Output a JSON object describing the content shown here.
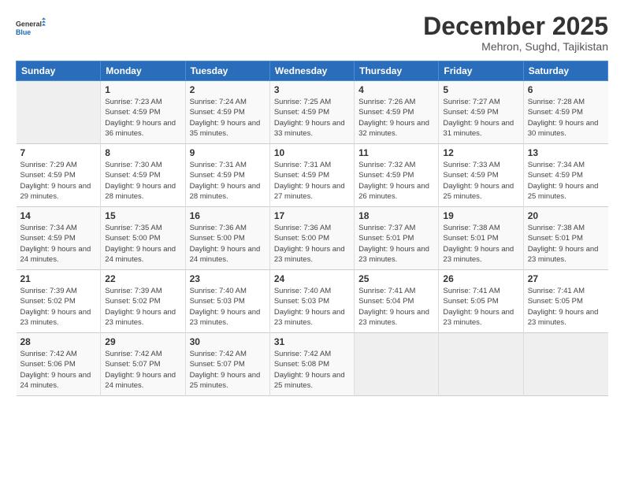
{
  "logo": {
    "line1": "General",
    "line2": "Blue"
  },
  "title": "December 2025",
  "location": "Mehron, Sughd, Tajikistan",
  "weekdays": [
    "Sunday",
    "Monday",
    "Tuesday",
    "Wednesday",
    "Thursday",
    "Friday",
    "Saturday"
  ],
  "weeks": [
    [
      {
        "day": "",
        "empty": true
      },
      {
        "day": "1",
        "rise": "7:23 AM",
        "set": "4:59 PM",
        "daylight": "9 hours and 36 minutes."
      },
      {
        "day": "2",
        "rise": "7:24 AM",
        "set": "4:59 PM",
        "daylight": "9 hours and 35 minutes."
      },
      {
        "day": "3",
        "rise": "7:25 AM",
        "set": "4:59 PM",
        "daylight": "9 hours and 33 minutes."
      },
      {
        "day": "4",
        "rise": "7:26 AM",
        "set": "4:59 PM",
        "daylight": "9 hours and 32 minutes."
      },
      {
        "day": "5",
        "rise": "7:27 AM",
        "set": "4:59 PM",
        "daylight": "9 hours and 31 minutes."
      },
      {
        "day": "6",
        "rise": "7:28 AM",
        "set": "4:59 PM",
        "daylight": "9 hours and 30 minutes."
      }
    ],
    [
      {
        "day": "7",
        "rise": "7:29 AM",
        "set": "4:59 PM",
        "daylight": "9 hours and 29 minutes."
      },
      {
        "day": "8",
        "rise": "7:30 AM",
        "set": "4:59 PM",
        "daylight": "9 hours and 28 minutes."
      },
      {
        "day": "9",
        "rise": "7:31 AM",
        "set": "4:59 PM",
        "daylight": "9 hours and 28 minutes."
      },
      {
        "day": "10",
        "rise": "7:31 AM",
        "set": "4:59 PM",
        "daylight": "9 hours and 27 minutes."
      },
      {
        "day": "11",
        "rise": "7:32 AM",
        "set": "4:59 PM",
        "daylight": "9 hours and 26 minutes."
      },
      {
        "day": "12",
        "rise": "7:33 AM",
        "set": "4:59 PM",
        "daylight": "9 hours and 25 minutes."
      },
      {
        "day": "13",
        "rise": "7:34 AM",
        "set": "4:59 PM",
        "daylight": "9 hours and 25 minutes."
      }
    ],
    [
      {
        "day": "14",
        "rise": "7:34 AM",
        "set": "4:59 PM",
        "daylight": "9 hours and 24 minutes."
      },
      {
        "day": "15",
        "rise": "7:35 AM",
        "set": "5:00 PM",
        "daylight": "9 hours and 24 minutes."
      },
      {
        "day": "16",
        "rise": "7:36 AM",
        "set": "5:00 PM",
        "daylight": "9 hours and 24 minutes."
      },
      {
        "day": "17",
        "rise": "7:36 AM",
        "set": "5:00 PM",
        "daylight": "9 hours and 23 minutes."
      },
      {
        "day": "18",
        "rise": "7:37 AM",
        "set": "5:01 PM",
        "daylight": "9 hours and 23 minutes."
      },
      {
        "day": "19",
        "rise": "7:38 AM",
        "set": "5:01 PM",
        "daylight": "9 hours and 23 minutes."
      },
      {
        "day": "20",
        "rise": "7:38 AM",
        "set": "5:01 PM",
        "daylight": "9 hours and 23 minutes."
      }
    ],
    [
      {
        "day": "21",
        "rise": "7:39 AM",
        "set": "5:02 PM",
        "daylight": "9 hours and 23 minutes."
      },
      {
        "day": "22",
        "rise": "7:39 AM",
        "set": "5:02 PM",
        "daylight": "9 hours and 23 minutes."
      },
      {
        "day": "23",
        "rise": "7:40 AM",
        "set": "5:03 PM",
        "daylight": "9 hours and 23 minutes."
      },
      {
        "day": "24",
        "rise": "7:40 AM",
        "set": "5:03 PM",
        "daylight": "9 hours and 23 minutes."
      },
      {
        "day": "25",
        "rise": "7:41 AM",
        "set": "5:04 PM",
        "daylight": "9 hours and 23 minutes."
      },
      {
        "day": "26",
        "rise": "7:41 AM",
        "set": "5:05 PM",
        "daylight": "9 hours and 23 minutes."
      },
      {
        "day": "27",
        "rise": "7:41 AM",
        "set": "5:05 PM",
        "daylight": "9 hours and 23 minutes."
      }
    ],
    [
      {
        "day": "28",
        "rise": "7:42 AM",
        "set": "5:06 PM",
        "daylight": "9 hours and 24 minutes."
      },
      {
        "day": "29",
        "rise": "7:42 AM",
        "set": "5:07 PM",
        "daylight": "9 hours and 24 minutes."
      },
      {
        "day": "30",
        "rise": "7:42 AM",
        "set": "5:07 PM",
        "daylight": "9 hours and 25 minutes."
      },
      {
        "day": "31",
        "rise": "7:42 AM",
        "set": "5:08 PM",
        "daylight": "9 hours and 25 minutes."
      },
      {
        "day": "",
        "empty": true
      },
      {
        "day": "",
        "empty": true
      },
      {
        "day": "",
        "empty": true
      }
    ]
  ],
  "labels": {
    "sunrise": "Sunrise:",
    "sunset": "Sunset:",
    "daylight": "Daylight:"
  }
}
